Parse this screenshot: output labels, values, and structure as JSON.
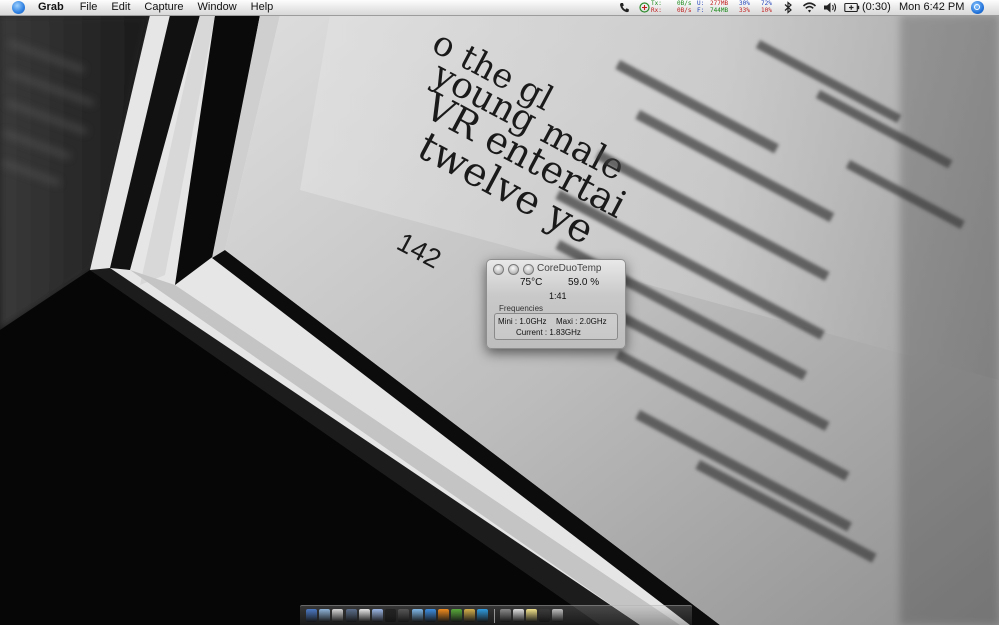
{
  "menubar": {
    "app_name": "Grab",
    "menus": [
      "File",
      "Edit",
      "Capture",
      "Window",
      "Help"
    ],
    "status": {
      "net_tx_label": "Tx:",
      "net_rx_label": "Rx:",
      "net_tx": "0B/s",
      "net_rx": "0B/s",
      "mem_u_label": "U:",
      "mem_f_label": "F:",
      "mem_used": "277MB",
      "mem_free": "744MB",
      "cpu1_a": "30%",
      "cpu1_b": "33%",
      "cpu2_a": "72%",
      "cpu2_b": "10%",
      "battery_time": "(0:30)",
      "clock": "Mon 6:42 PM"
    },
    "icons": [
      "apple-icon",
      "phone-icon",
      "network-icon",
      "bluetooth-icon",
      "wifi-icon",
      "volume-icon",
      "battery-icon",
      "spotlight-icon"
    ]
  },
  "wallpaper": {
    "page_number": "142",
    "lines": [
      "o the gl",
      "young male",
      "VR entertai",
      "twelve ye"
    ]
  },
  "widget": {
    "title": "CoreDuoTemp",
    "temperature": "75°C",
    "usage": "59.0  %",
    "time": "1:41",
    "frequencies_label": "Frequencies",
    "mini": "Mini : 1.0GHz",
    "maxi": "Maxi : 2.0GHz",
    "current": "Current : 1.83GHz"
  },
  "dock": {
    "apps": [
      "finder",
      "apps",
      "network",
      "mail",
      "ical",
      "itunes",
      "terminal",
      "console",
      "ichat",
      "safari",
      "vlc",
      "adium",
      "preview",
      "skype",
      "calculator",
      "textedit",
      "stickies",
      "activity-monitor",
      "trash"
    ],
    "colors": [
      "#4a78c4",
      "#8fb3d8",
      "#d8d8d8",
      "#5b6d8a",
      "#e8e8e8",
      "#9db7e6",
      "#222222",
      "#555555",
      "#7fb8e8",
      "#3b8de0",
      "#f08a1c",
      "#58a83a",
      "#d6b04a",
      "#2e9be0",
      "#888888",
      "#e0e0e0",
      "#f2e28a",
      "#3a3a3a",
      "#bfbfbf"
    ]
  }
}
